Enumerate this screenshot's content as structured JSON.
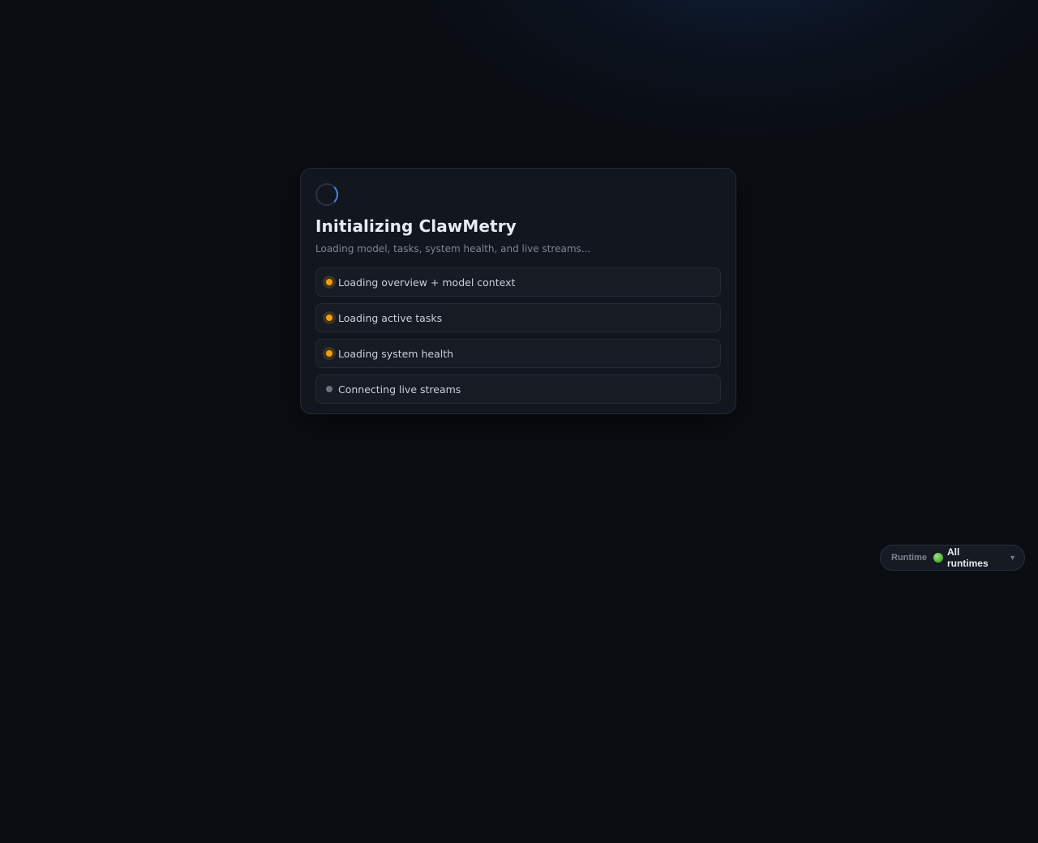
{
  "loader": {
    "title": "Initializing ClawMetry",
    "subtitle": "Loading model, tasks, system health, and live streams...",
    "steps": [
      {
        "label": "Loading overview + model context",
        "status": "loading"
      },
      {
        "label": "Loading active tasks",
        "status": "loading"
      },
      {
        "label": "Loading system health",
        "status": "loading"
      },
      {
        "label": "Connecting live streams",
        "status": "pending"
      }
    ]
  },
  "runtime_selector": {
    "label": "Runtime",
    "value": "All runtimes",
    "chevron": "▼"
  },
  "colors": {
    "background": "#0a0d12",
    "card": "#12161e",
    "spinner_accent": "#4a84e8",
    "loading_dot": "#f59e0b",
    "pending_dot": "#6b7280",
    "runtime_status": "#5cb83c"
  },
  "icons": {
    "spinner": "spinner-icon",
    "runtime_status": "green-circle-icon",
    "dropdown": "chevron-down-icon"
  }
}
